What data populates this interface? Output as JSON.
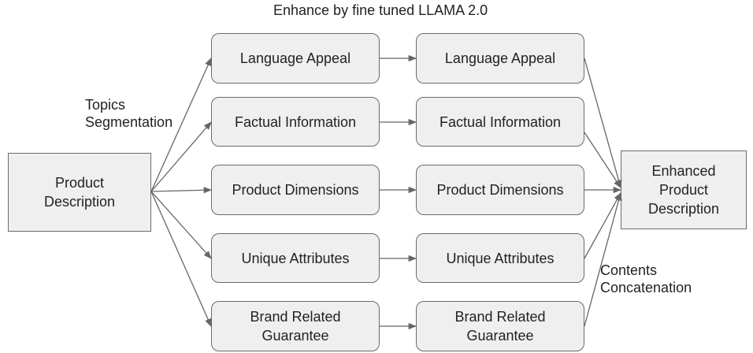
{
  "title": "Enhance by fine tuned LLAMA 2.0",
  "input": {
    "label": "Product\nDescription"
  },
  "output": {
    "label": "Enhanced\nProduct\nDescription"
  },
  "edge_labels": {
    "segmentation": "Topics\nSegmentation",
    "concatenation": "Contents\nConcatenation"
  },
  "topics": [
    "Language Appeal",
    "Factual Information",
    "Product Dimensions",
    "Unique Attributes",
    "Brand Related\nGuarantee"
  ],
  "enhanced_topics": [
    "Language Appeal",
    "Factual Information",
    "Product Dimensions",
    "Unique Attributes",
    "Brand Related\nGuarantee"
  ],
  "colors": {
    "box_fill": "#efefef",
    "box_border": "#6b6b6b",
    "arrow": "#666666"
  }
}
